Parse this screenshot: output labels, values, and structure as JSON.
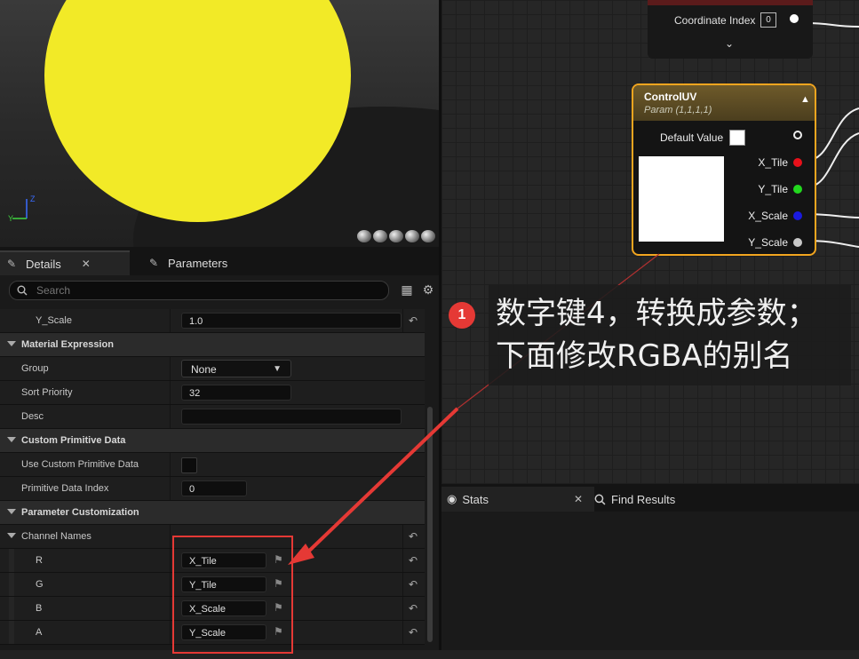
{
  "details": {
    "tabs": [
      {
        "label": "Details"
      },
      {
        "label": "Parameters"
      }
    ],
    "search_placeholder": "Search",
    "rows": {
      "y_scale_label": "Y_Scale",
      "y_scale_value": "1.0",
      "material_expression": "Material Expression",
      "group_label": "Group",
      "group_value": "None",
      "sort_priority_label": "Sort Priority",
      "sort_priority_value": "32",
      "desc_label": "Desc",
      "custom_primitive_data": "Custom Primitive Data",
      "use_custom_label": "Use Custom Primitive Data",
      "primitive_index_label": "Primitive Data Index",
      "primitive_index_value": "0",
      "parameter_customization": "Parameter Customization",
      "channel_names_label": "Channel Names",
      "channels": [
        {
          "label": "R",
          "value": "X_Tile"
        },
        {
          "label": "G",
          "value": "Y_Tile"
        },
        {
          "label": "B",
          "value": "X_Scale"
        },
        {
          "label": "A",
          "value": "Y_Scale"
        }
      ]
    }
  },
  "graph": {
    "texcoord_node": {
      "coord_label": "Coordinate Index",
      "coord_value": "0"
    },
    "control_node": {
      "title": "ControlUV",
      "subtitle": "Param (1,1,1,1)",
      "default_label": "Default Value",
      "pins": [
        {
          "label": "X_Tile",
          "color": "#e8101a"
        },
        {
          "label": "Y_Tile",
          "color": "#22d81e"
        },
        {
          "label": "X_Scale",
          "color": "#1a1ae0"
        },
        {
          "label": "Y_Scale",
          "color": "#c8c8c8"
        }
      ]
    }
  },
  "bottom_tabs": [
    {
      "label": "Stats"
    },
    {
      "label": "Find Results"
    }
  ],
  "annotation": {
    "badge": "1",
    "line1": "数字键4，转换成参数；",
    "line2": "下面修改RGBA的别名"
  }
}
